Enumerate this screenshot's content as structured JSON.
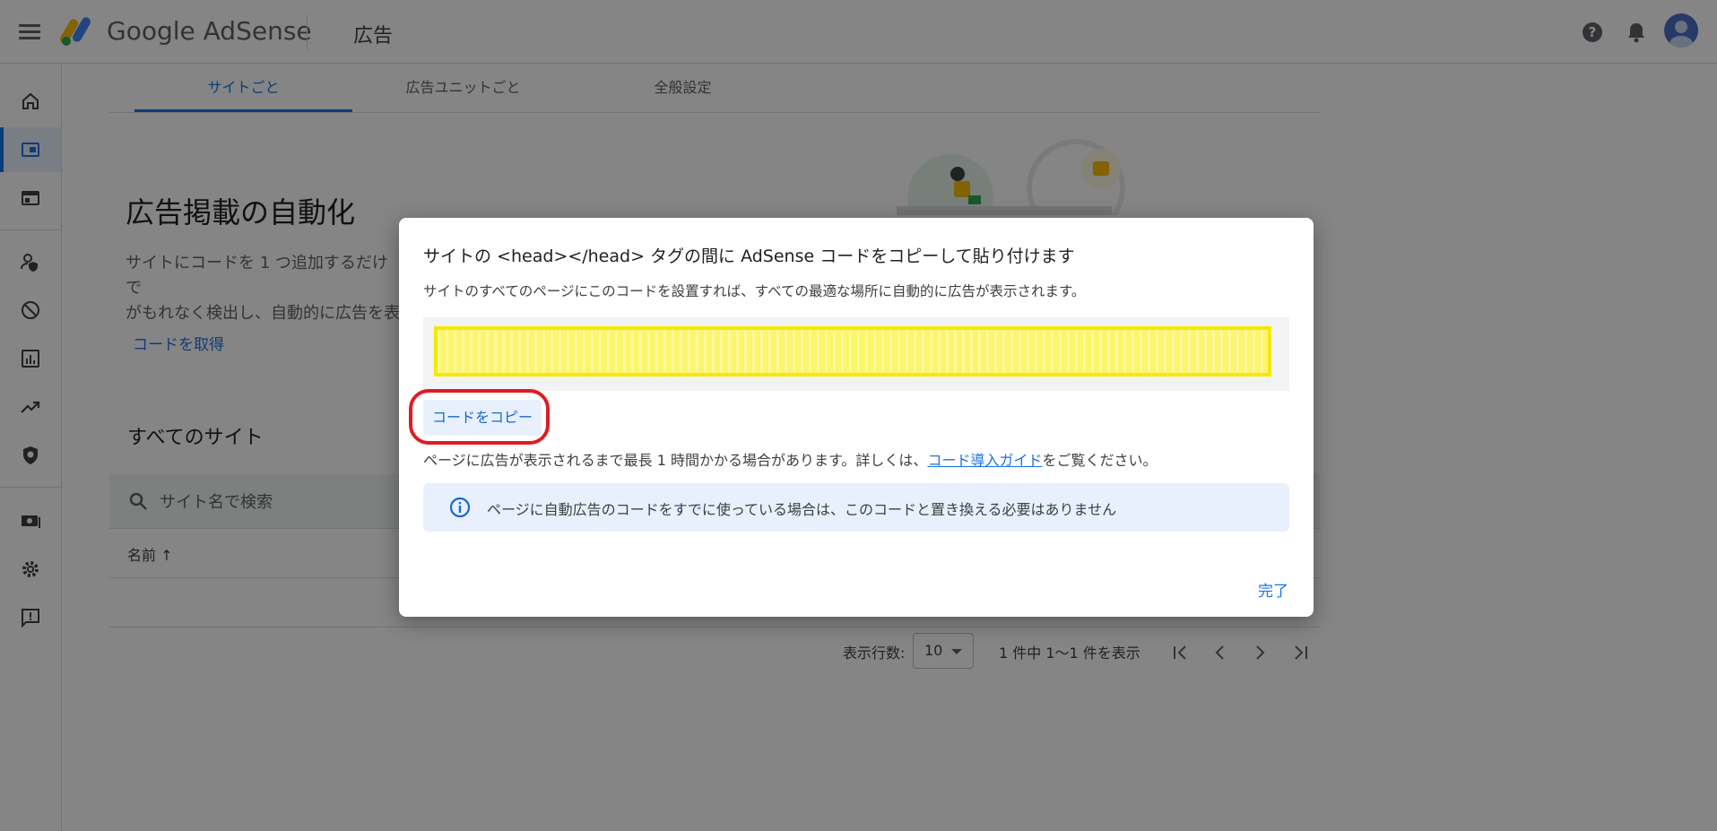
{
  "app": {
    "brand": "Google AdSense",
    "page_name": "広告",
    "icons": [
      "menu-icon",
      "help-icon",
      "bell-icon",
      "avatar"
    ]
  },
  "rail": {
    "items": [
      {
        "icon": "home-icon"
      },
      {
        "icon": "ads-icon",
        "active": true
      },
      {
        "icon": "browse-icon"
      },
      {
        "icon": "privacy-messaging-icon"
      },
      {
        "icon": "block-icon"
      },
      {
        "icon": "reports-icon"
      },
      {
        "icon": "optimization-icon"
      },
      {
        "icon": "policy-center-icon"
      },
      {
        "icon": "payments-icon"
      },
      {
        "icon": "settings-icon"
      },
      {
        "icon": "feedback-icon"
      }
    ]
  },
  "tabs": [
    {
      "label": "サイトごと",
      "active": true
    },
    {
      "label": "広告ユニットごと"
    },
    {
      "label": "全般設定"
    }
  ],
  "main": {
    "title": "広告掲載の自動化",
    "description": "サイトにコードを 1 つ追加するだけで\nがもれなく検出し、自動的に広告を表",
    "get_code_link": "コードを取得",
    "section_title": "すべてのサイト",
    "search_placeholder": "サイト名で検索",
    "column_name": "名前 ↑",
    "rows_per_page_label": "表示行数:",
    "rows_per_page_value": "10",
    "range_text": "1 件中 1〜1 件を表示"
  },
  "dialog": {
    "title": "サイトの <head></head> タグの間に AdSense コードをコピーして貼り付けます",
    "subtitle": "サイトのすべてのページにこのコードを設置すれば、すべての最適な場所に自動的に広告が表示されます。",
    "copy_button": "コードをコピー",
    "note_before": "ページに広告が表示されるまで最長 1 時間かかる場合があります。詳しくは、",
    "note_link": "コード導入ガイド",
    "note_after": "をご覧ください。",
    "info_text": "ページに自動広告のコードをすでに使っている場合は、このコードと置き換える必要はありません",
    "done_button": "完了"
  },
  "colors": {
    "accent": "#1a73e8",
    "scrim": "rgba(0,0,0,0.48)",
    "redaction": "#f6e800",
    "highlight_ring": "#e01b24"
  }
}
